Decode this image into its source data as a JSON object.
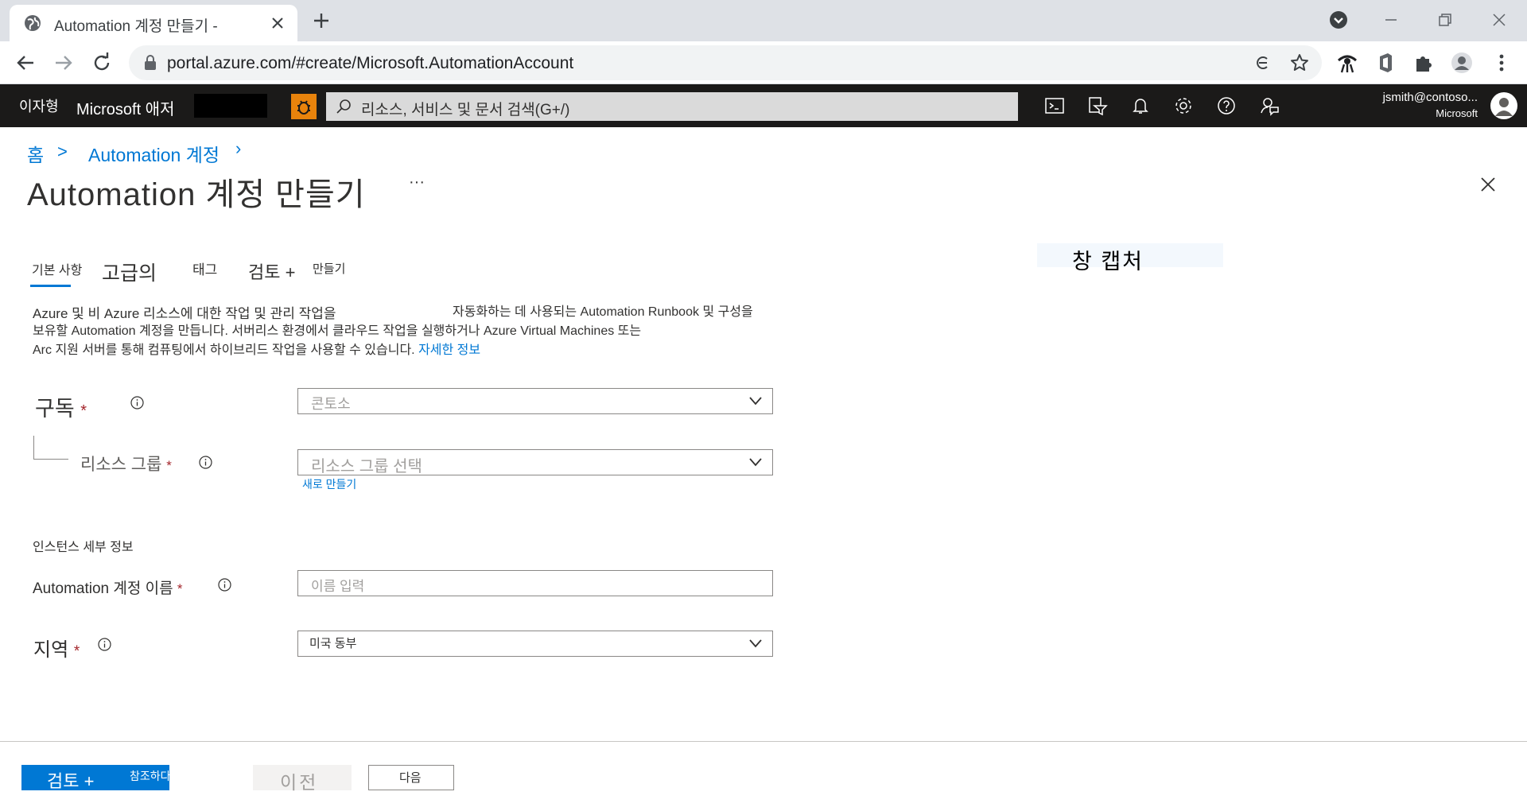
{
  "browser": {
    "tab_title": "Automation 계정 만들기 -",
    "url": "portal.azure.com/#create/Microsoft.AutomationAccount"
  },
  "azure_header": {
    "tenant_short": "이자형",
    "brand": "Microsoft 애저",
    "search_placeholder": "리소스, 서비스 및 문서 검색(G+/)",
    "user_email": "jsmith@contoso...",
    "user_org": "Microsoft"
  },
  "breadcrumb": {
    "home": "홈",
    "sep": ">",
    "parent": "Automation 계정",
    "parent_sep": "›"
  },
  "page": {
    "title": "Automation 계정 만들기",
    "more": "···",
    "capture_label": "창 캡처"
  },
  "tabs": {
    "basics": "기본 사항",
    "advanced": "고급의",
    "tags": "태그",
    "review_a": "검토 +",
    "review_b": "만들기"
  },
  "description": {
    "line1a": "Azure 및 비 Azure 리소스에 대한 작업 및 관리 작업을",
    "line1b": "자동화하는 데 사용되는 Automation Runbook 및 구성을",
    "line2": "보유할 Automation 계정을 만듭니다. 서버리스 환경에서 클라우드 작업을 실행하거나 Azure Virtual Machines 또는",
    "line3": "Arc 지원 서버를 통해 컴퓨팅에서 하이브리드 작업을 사용할 수 있습니다.",
    "link": "자세한 정보"
  },
  "form": {
    "subscription_label": "구독",
    "subscription_value": "콘토소",
    "resource_group_label": "리소스 그룹",
    "resource_group_placeholder": "리소스 그룹 선택",
    "new_link": "새로 만들기",
    "instance_section": "인스턴스 세부 정보",
    "account_name_label": "Automation 계정 이름",
    "account_name_placeholder": "이름 입력",
    "region_label": "지역",
    "region_value": "미국 동부",
    "required_mark": "*"
  },
  "footer": {
    "review_a": "검토 +",
    "review_b": "참조하다",
    "previous": "이전",
    "next": "다음"
  },
  "colors": {
    "accent": "#0078d4",
    "header_bg": "#1b1a19",
    "bug_button": "#e8830c"
  }
}
